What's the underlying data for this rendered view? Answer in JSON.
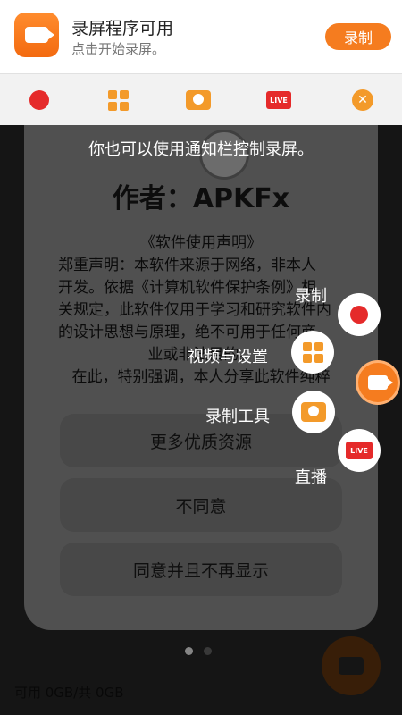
{
  "notification": {
    "title": "录屏程序可用",
    "subtitle": "点击开始录屏。",
    "button": "录制"
  },
  "toolbar": {
    "items": [
      {
        "icon": "record-dot-icon"
      },
      {
        "icon": "grid-settings-icon"
      },
      {
        "icon": "tools-icon"
      },
      {
        "icon": "live-icon",
        "label": "LIVE"
      },
      {
        "icon": "close-icon"
      }
    ]
  },
  "hint": "你也可以使用通知栏控制录屏。",
  "dialog": {
    "author": "作者：APKFx",
    "heading": "《软件使用声明》",
    "body_lines": [
      "郑重声明：本软件来源于网络，非本人",
      "开发。依据《计算机软件保护条例》相",
      "关规定，此软件仅用于学习和研究软件内",
      "的设计思想与原理，绝不可用于任何商",
      "业或非法目的。",
      "在此，特别强调，本人分享此软件纯粹"
    ],
    "buttons": [
      "更多优质资源",
      "不同意",
      "同意并且不再显示"
    ]
  },
  "floating_menu": {
    "record": "录制",
    "video_settings": "视频与设置",
    "tools": "录制工具",
    "live": "直播"
  },
  "storage": "可用 0GB/共 0GB",
  "colors": {
    "accent": "#f57c1f",
    "record": "#e52a2a"
  }
}
